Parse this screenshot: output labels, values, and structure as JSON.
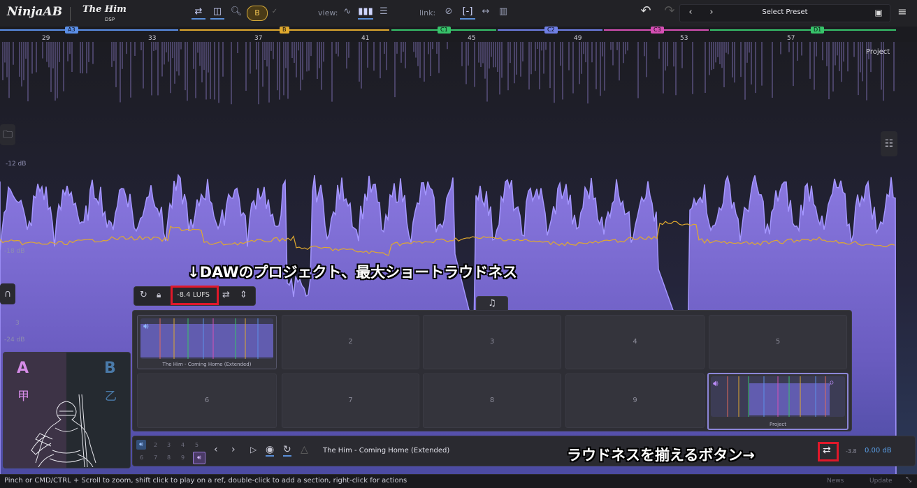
{
  "toolbar": {
    "logo": "NinjaAB",
    "dsp_logo_top": "The Him",
    "dsp_logo_bottom": "DSP",
    "ab_button": "B",
    "view_label": "view:",
    "link_label": "link:",
    "preset_label": "Select Preset",
    "icons": [
      "swap-icon",
      "align-icon",
      "zoom-icon",
      "check-icon",
      "waveform-view-icon",
      "spectrum-view-icon",
      "stack-view-icon",
      "link-icon",
      "bracket-link-icon",
      "arrows-link-icon",
      "columns-link-icon",
      "undo-icon",
      "redo-icon",
      "prev-preset-icon",
      "next-preset-icon",
      "save-icon",
      "menu-icon"
    ]
  },
  "ruler": {
    "bars": [
      "29",
      "33",
      "37",
      "41",
      "45",
      "49",
      "53",
      "57"
    ],
    "sections": [
      {
        "tag": "A3",
        "color": "#5b8fe8"
      },
      {
        "tag": "B",
        "color": "#e0a92e"
      },
      {
        "tag": "C1",
        "color": "#37c36a"
      },
      {
        "tag": "C2",
        "color": "#6f7fe6"
      },
      {
        "tag": "C3",
        "color": "#d64fb4"
      },
      {
        "tag": "D1",
        "color": "#37c36a"
      }
    ]
  },
  "waveform": {
    "project_label": "Project",
    "db_labels": [
      "-12 dB",
      "-18 dB",
      "-24 dB"
    ],
    "side_number": "3",
    "accent_fill": "#7b6ad8",
    "loudness_line_color": "#e0a92e"
  },
  "annotations": {
    "top": "↓DAWのプロジェクト、最大ショートラウドネス",
    "bottom": "ラウドネスを揃えるボタン→"
  },
  "mini_toolbar": {
    "lufs": "-8.4 LUFS",
    "icons": [
      "sync-icon",
      "lock-icon",
      "match-loudness-icon",
      "fit-height-icon"
    ]
  },
  "grid": {
    "tab_icon": "music-note-icon",
    "slots": [
      {
        "num": "1",
        "caption": "The Him - Coming Home (Extended)",
        "filled": true
      },
      {
        "num": "2"
      },
      {
        "num": "3"
      },
      {
        "num": "4"
      },
      {
        "num": "5"
      },
      {
        "num": "6"
      },
      {
        "num": "7"
      },
      {
        "num": "8"
      },
      {
        "num": "9"
      },
      {
        "num": "10",
        "caption": "Project",
        "filled": true
      }
    ]
  },
  "card": {
    "a": "A",
    "b": "B",
    "a_kanji": "甲",
    "b_kanji": "乙"
  },
  "transport": {
    "nums_top": [
      "2",
      "3",
      "4",
      "5"
    ],
    "nums_bottom": [
      "6",
      "7",
      "8",
      "9"
    ],
    "track_title": "The Him - Coming Home (Extended)",
    "meter_value": "-3.8",
    "gain_value": "0.00 dB"
  },
  "status": {
    "hint": "Pinch or CMD/CTRL + Scroll to zoom, shift click to play on a ref, double-click to add a section, right-click for actions",
    "news": "News",
    "update": "Update"
  }
}
